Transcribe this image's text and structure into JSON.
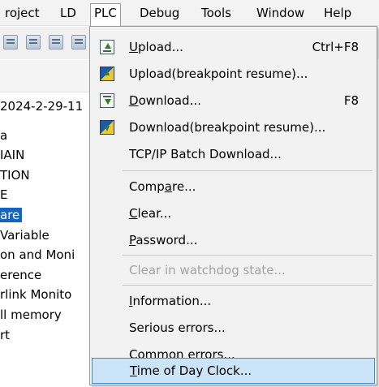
{
  "menubar": {
    "items": [
      {
        "label": "roject",
        "active": false
      },
      {
        "label": "LD",
        "active": false
      },
      {
        "label": "PLC",
        "active": true
      },
      {
        "label": "Debug",
        "active": false
      },
      {
        "label": "Tools",
        "active": false
      },
      {
        "label": "Window",
        "active": false
      },
      {
        "label": "Help",
        "active": false
      }
    ]
  },
  "toolbar": {
    "icons": [
      "save-all-icon",
      "save-icon",
      "compile-icon",
      "build-icon"
    ]
  },
  "tree": {
    "date": "2024-2-29-11",
    "items": [
      {
        "label": "a",
        "selected": false
      },
      {
        "label": "IAIN",
        "selected": false
      },
      {
        "label": "TION",
        "selected": false
      },
      {
        "label": "E",
        "selected": false
      },
      {
        "label": "are",
        "selected": true
      },
      {
        "label": "Variable",
        "selected": false
      },
      {
        "label": "on and Moni",
        "selected": false
      },
      {
        "label": "erence",
        "selected": false
      },
      {
        "label": "rlink Monito",
        "selected": false
      },
      {
        "label": "ll memory",
        "selected": false
      },
      {
        "label": "rt",
        "selected": false
      }
    ]
  },
  "plc_menu": {
    "upload": {
      "label": "Upload...",
      "shortcut": "Ctrl+F8",
      "icon": "upload-icon"
    },
    "upload_resume": {
      "label": "Upload(breakpoint resume)...",
      "icon": "upload-resume-icon"
    },
    "download": {
      "label": "Download...",
      "shortcut": "F8",
      "icon": "download-icon"
    },
    "download_resume": {
      "label": "Download(breakpoint resume)...",
      "icon": "download-resume-icon"
    },
    "tcpip_batch": {
      "label": "TCP/IP Batch Download..."
    },
    "compare": {
      "label": "Compare..."
    },
    "clear": {
      "label": "Clear..."
    },
    "password": {
      "label": "Password..."
    },
    "clear_watchdog": {
      "label": "Clear in watchdog state...",
      "disabled": true
    },
    "information": {
      "label": "Information..."
    },
    "serious_errors": {
      "label": "Serious errors..."
    },
    "common_errors": {
      "label": "Common errors..."
    },
    "time_of_day_clock": {
      "label": "Time of Day Clock...",
      "highlighted": true
    }
  },
  "colors": {
    "selection": "#1565c0",
    "menu_highlight": "#cce4f7",
    "menu_highlight_border": "#3c8edb",
    "menu_background": "#f2f2f2",
    "disabled_text": "#a3a3a3"
  }
}
